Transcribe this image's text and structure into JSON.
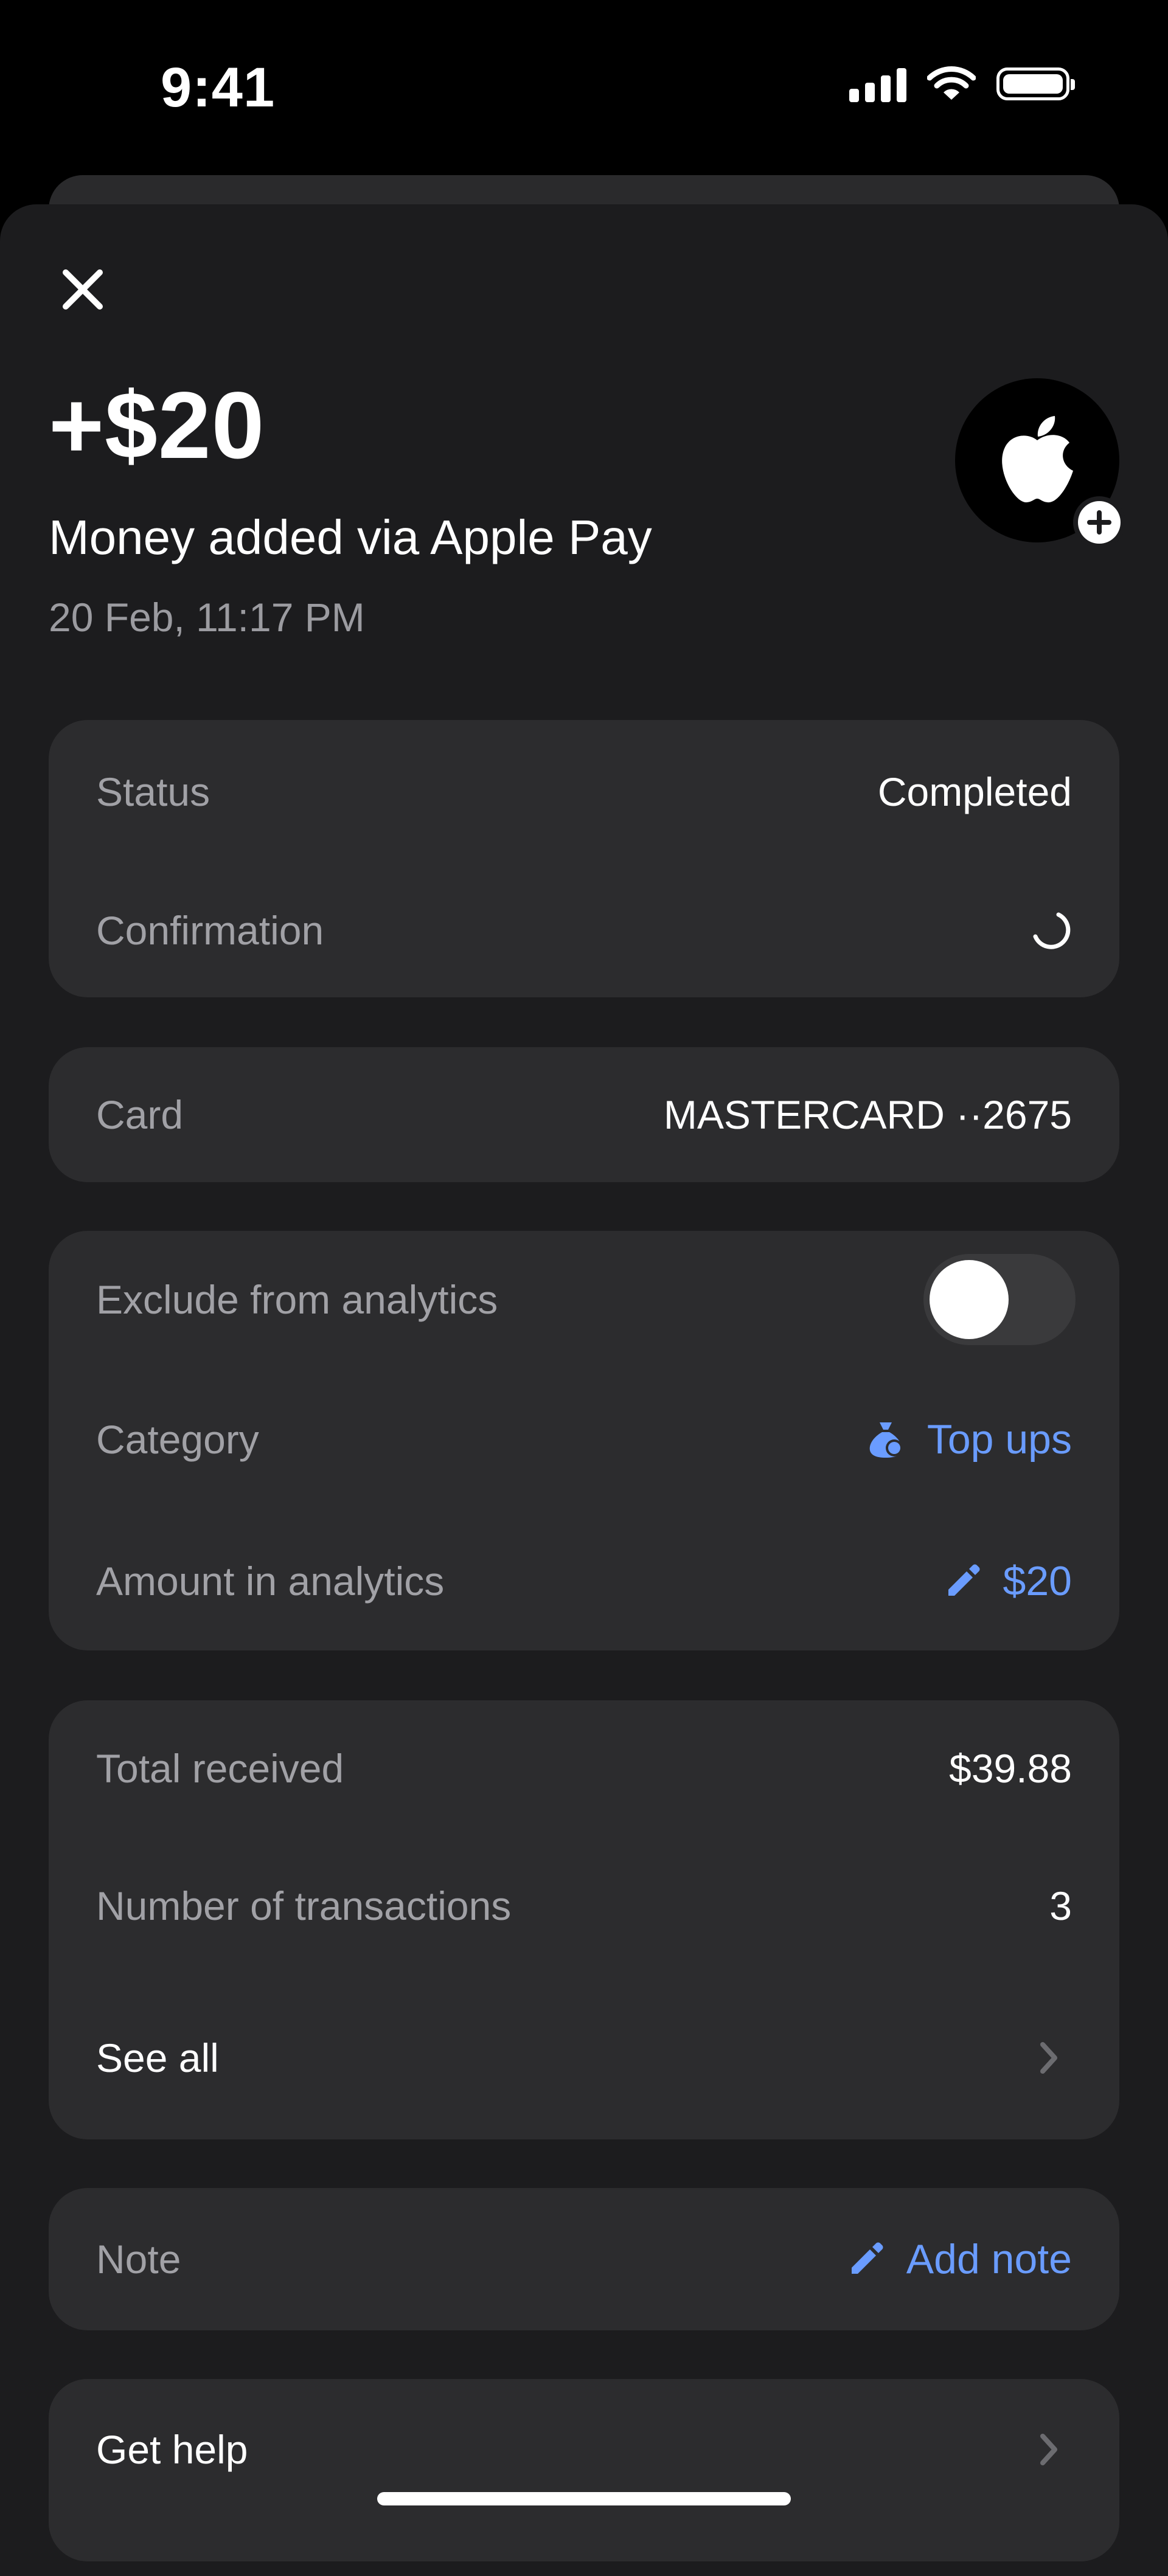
{
  "status_bar": {
    "time": "9:41"
  },
  "header": {
    "amount": "+$20",
    "title": "Money added via Apple Pay",
    "date": "20 Feb, 11:17 PM"
  },
  "status_card": {
    "status_label": "Status",
    "status_value": "Completed",
    "confirmation_label": "Confirmation"
  },
  "card_info": {
    "label": "Card",
    "value": "MASTERCARD ··2675"
  },
  "analytics": {
    "exclude_label": "Exclude from analytics",
    "exclude_enabled": false,
    "category_label": "Category",
    "category_value": "Top ups",
    "amount_label": "Amount in analytics",
    "amount_value": "$20"
  },
  "summary": {
    "total_received_label": "Total received",
    "total_received_value": "$39.88",
    "transactions_label": "Number of transactions",
    "transactions_value": "3",
    "see_all_label": "See all"
  },
  "note": {
    "label": "Note",
    "action": "Add note"
  },
  "help": {
    "label": "Get help"
  },
  "colors": {
    "accent": "#6a9cff",
    "sheet_bg": "#1c1c1e",
    "card_bg": "#2c2c2e",
    "secondary_text": "#a1a1a6"
  }
}
